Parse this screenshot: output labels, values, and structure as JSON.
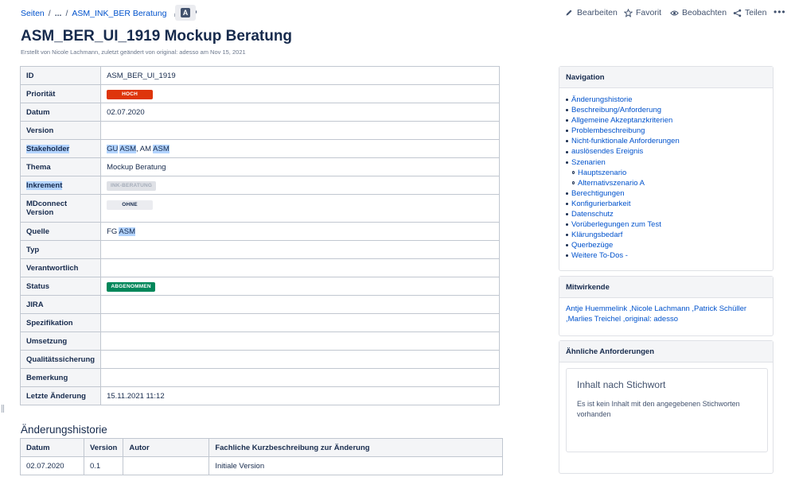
{
  "breadcrumb": {
    "root": "Seiten",
    "sep1": "/",
    "ellipsis": "...",
    "sep2": "/",
    "parent": "ASM_INK_BER Beratung"
  },
  "actions": {
    "edit": "Bearbeiten",
    "favorite": "Favorit",
    "watch": "Beobachten",
    "share": "Teilen",
    "more": "•••"
  },
  "page": {
    "title": "ASM_BER_UI_1919 Mockup Beratung",
    "byline": "Erstellt von Nicole Lachmann, zuletzt geändert von original: adesso am Nov 15, 2021"
  },
  "info": {
    "id_label": "ID",
    "id_value": "ASM_BER_UI_1919",
    "prio_label": "Priorität",
    "prio_value": "HOCH",
    "date_label": "Datum",
    "date_value": "02.07.2020",
    "version_label": "Version",
    "stake_label": "Stakeholder",
    "stake_a": "GU",
    "stake_b": "ASM",
    "stake_c": ", AM",
    "stake_d": "ASM",
    "theme_label": "Thema",
    "theme_value": "Mockup Beratung",
    "incr_label": "Inkrement",
    "incr_value": "INK-BERATUNG",
    "md_label": "MDconnect Version",
    "md_value": "OHNE",
    "source_label": "Quelle",
    "source_a": "FG",
    "source_b": "ASM",
    "type_label": "Typ",
    "resp_label": "Verantwortlich",
    "status_label": "Status",
    "status_value": "ABGENOMMEN",
    "jira_label": "JIRA",
    "spec_label": "Spezifikation",
    "impl_label": "Umsetzung",
    "qa_label": "Qualitätssicherung",
    "note_label": "Bemerkung",
    "last_label": "Letzte Änderung",
    "last_value": "15.11.2021 11:12"
  },
  "history": {
    "title": "Änderungshistorie",
    "headers": [
      "Datum",
      "Version",
      "Autor",
      "Fachliche Kurzbeschreibung zur Änderung"
    ],
    "row": [
      "02.07.2020",
      "0.1",
      "",
      "Initiale Version"
    ]
  },
  "navigation": {
    "title": "Navigation",
    "items": [
      "Änderungshistorie",
      "Beschreibung/Anforderung",
      "Allgemeine Akzeptanzkriterien",
      "Problembeschreibung",
      "Nicht-funktionale Anforderungen",
      "auslösendes Ereignis",
      "Szenarien",
      "Hauptszenario",
      "Alternativszenario A",
      "Berechtigungen",
      "Konfigurierbarkeit",
      "Datenschutz",
      "Vorüberlegungen zum Test",
      "Klärungsbedarf",
      "Querbezüge",
      "Weitere To-Dos -"
    ]
  },
  "contributors": {
    "title": "Mitwirkende",
    "text": "Antje Huemmelink ,Nicole Lachmann ,Patrick Schüller ,Marlies Treichel ,original: adesso"
  },
  "similar": {
    "title": "Ähnliche Anforderungen",
    "box_title": "Inhalt nach Stichwort",
    "box_text": "Es ist kein Inhalt mit den angegebenen Stichworten vorhanden"
  },
  "colors": {
    "link": "#0052cc",
    "text": "#172b4d",
    "red": "#de350b",
    "green": "#00875a",
    "highlight": "#b3d4ff"
  }
}
